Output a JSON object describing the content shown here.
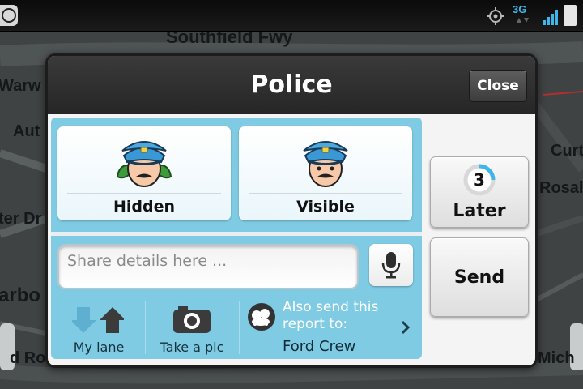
{
  "status_bar": {
    "network_label": "3G",
    "icons": [
      "app-notification-icon",
      "gps-icon",
      "network-arrows-icon",
      "signal-icon",
      "battery-icon"
    ]
  },
  "map": {
    "labels": [
      "Southfield Fwy",
      "Warw",
      "Aut",
      "Curt",
      "Rosalie",
      "ter Dr",
      "arbo",
      "d Ro",
      "Mich"
    ]
  },
  "dialog": {
    "title": "Police",
    "close_label": "Close",
    "report_types": [
      {
        "label": "Hidden",
        "icon": "police-hidden-icon"
      },
      {
        "label": "Visible",
        "icon": "police-visible-icon"
      }
    ],
    "details_placeholder": "Share details here ...",
    "bottom": {
      "lane_label": "My lane",
      "pic_label": "Take a pic",
      "send_to_label": "Also send this report to:",
      "send_to_target": "Ford Crew"
    },
    "later": {
      "countdown": "3",
      "label": "Later"
    },
    "send_label": "Send"
  },
  "colors": {
    "panel_blue": "#7fcbe4",
    "header_dark": "#2e2e2e",
    "hat_blue": "#3a98d4",
    "leaf_green": "#3e9b3a",
    "status_accent": "#3fb6ea"
  }
}
